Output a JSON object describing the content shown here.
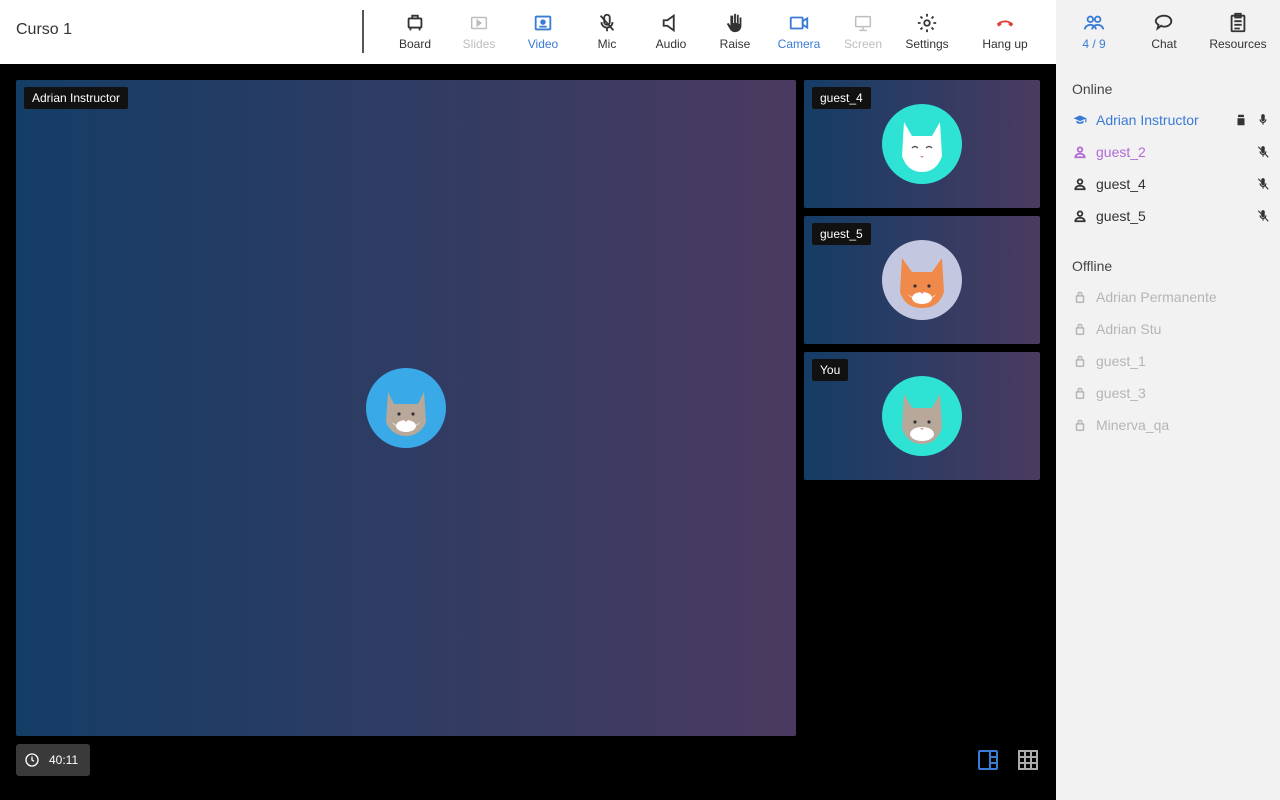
{
  "course_title": "Curso 1",
  "toolbar": {
    "board": "Board",
    "slides": "Slides",
    "video": "Video",
    "mic": "Mic",
    "audio": "Audio",
    "raise": "Raise",
    "camera": "Camera",
    "screen": "Screen",
    "settings": "Settings",
    "hangup": "Hang up"
  },
  "side_tabs": {
    "participants_count": "4 / 9",
    "chat": "Chat",
    "resources": "Resources"
  },
  "panel": {
    "online_heading": "Online",
    "offline_heading": "Offline",
    "online": [
      {
        "name": "Adrian Instructor",
        "role": "instructor"
      },
      {
        "name": "guest_2",
        "role": "guest"
      },
      {
        "name": "guest_4",
        "role": "guest"
      },
      {
        "name": "guest_5",
        "role": "guest"
      }
    ],
    "offline": [
      {
        "name": "Adrian Permanente"
      },
      {
        "name": "Adrian Stu"
      },
      {
        "name": "guest_1"
      },
      {
        "name": "guest_3"
      },
      {
        "name": "Minerva_qa"
      }
    ]
  },
  "tiles": {
    "main": "Adrian Instructor",
    "t1": "guest_4",
    "t2": "guest_5",
    "t3": "You"
  },
  "timer": "40:11",
  "colors": {
    "accent": "#3a7bd5",
    "hangup": "#e0403a",
    "guest_highlight": "#b36ad8"
  }
}
